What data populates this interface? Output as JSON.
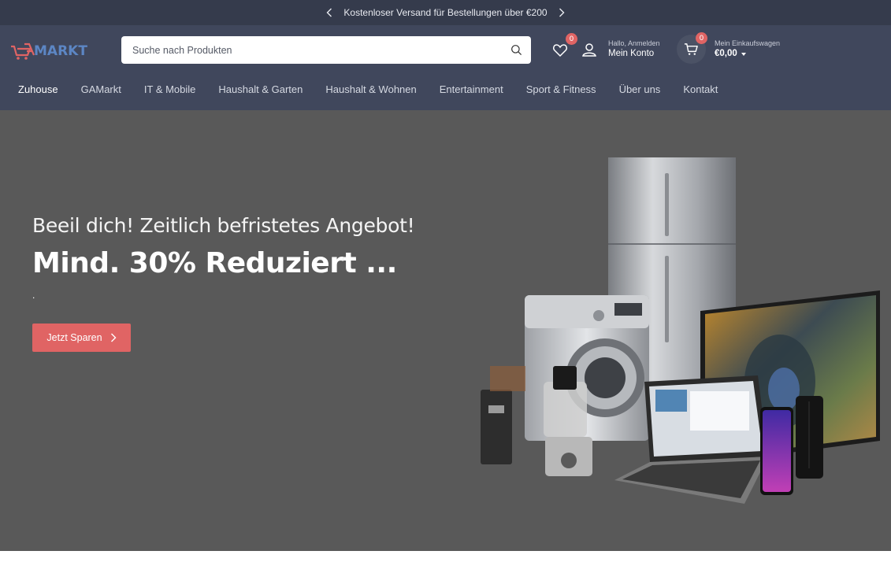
{
  "promo": {
    "text": "Kostenloser Versand für Bestellungen über €200"
  },
  "header": {
    "logo_text": "MARKT",
    "search": {
      "placeholder": "Suche nach Produkten"
    },
    "wishlist": {
      "count": "0"
    },
    "account": {
      "greeting": "Hallo, Anmelden",
      "label": "Mein Konto"
    },
    "cart": {
      "count": "0",
      "label": "Mein Einkaufswagen",
      "total": "€0,00"
    }
  },
  "nav": {
    "items": [
      {
        "label": "Zuhouse",
        "active": true
      },
      {
        "label": "GAMarkt"
      },
      {
        "label": "IT & Mobile"
      },
      {
        "label": "Haushalt & Garten"
      },
      {
        "label": "Haushalt & Wohnen"
      },
      {
        "label": "Entertainment"
      },
      {
        "label": "Sport & Fitness"
      },
      {
        "label": "Über uns"
      },
      {
        "label": "Kontakt"
      }
    ]
  },
  "hero": {
    "subtitle": "Beeil dich! Zeitlich befristetes Angebot!",
    "title": "Mind. 30% Reduziert ...",
    "dot": ".",
    "cta_label": "Jetzt Sparen"
  },
  "colors": {
    "promo_bg": "#353b4c",
    "header_bg": "#40475c",
    "hero_bg": "#595959",
    "accent": "#e06464",
    "logo_blue": "#5c86c4"
  },
  "icons": [
    "chevron-left-icon",
    "chevron-right-icon",
    "search-icon",
    "heart-icon",
    "user-icon",
    "cart-icon"
  ]
}
